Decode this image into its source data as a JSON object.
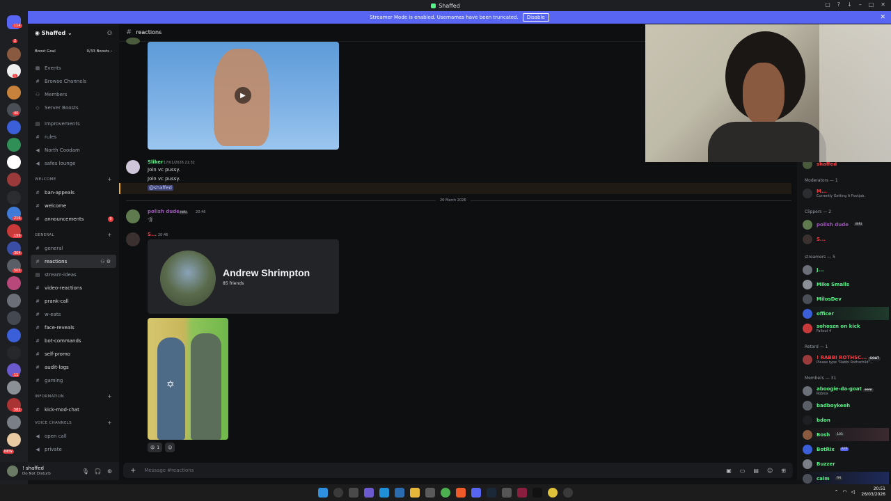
{
  "window": {
    "title": "Shaffed"
  },
  "banner": {
    "text": "Streamer Mode is enabled. Usernames have been truncated.",
    "button": "Disable"
  },
  "guild_badges": [
    "114",
    "2",
    "1",
    "40",
    "216",
    "199",
    "304",
    "505",
    "13",
    "11",
    "582",
    "NEW"
  ],
  "server": {
    "name": "Shaffed",
    "boost_label": "Boost Goal",
    "boost_count": "0/33 Boosts",
    "nav": [
      {
        "label": "Events",
        "icon": "calendar-icon"
      },
      {
        "label": "Browse Channels",
        "icon": "browse-icon"
      },
      {
        "label": "Members",
        "icon": "members-icon"
      },
      {
        "label": "Server Boosts",
        "icon": "boost-icon"
      }
    ],
    "channels_top": [
      "Improvements",
      "rules",
      "North Coodam",
      "safes lounge"
    ],
    "cat_welcome": "WELCOME",
    "welcome_channels": [
      "ban-appeals",
      "welcome",
      "announcements"
    ],
    "announcements_unread": "9",
    "cat_general": "GENERAL",
    "general_channels": [
      "general",
      "reactions",
      "stream-ideas",
      "video-reactions",
      "prank-call",
      "w-eats",
      "face-reveals",
      "bot-commands",
      "self-promo",
      "audit-logs",
      "gaming"
    ],
    "cat_information": "INFORMATION",
    "information_channels": [
      "kick-mod-chat"
    ],
    "cat_voice": "VOICE CHANNELS",
    "voice_channels": [
      "open call",
      "private"
    ]
  },
  "user": {
    "name": "! shaffed",
    "status": "Do Not Disturb"
  },
  "chat": {
    "channel": "reactions",
    "messages": [
      {
        "author": "Sliker",
        "time": "17/01/2026 21:32",
        "lines": [
          "Join vc pussy.",
          "Join vc pussy."
        ],
        "mention": "@shaffed"
      },
      {
        "author": "polish dude",
        "tag": "INRI",
        "time": "20:46",
        "text": "-Jj"
      },
      {
        "author": "S...",
        "time": "20:46"
      }
    ],
    "date_divider": "26 March 2026",
    "profile_card": {
      "name": "Andrew Shrimpton",
      "friends": "85 friends"
    },
    "reactions": [
      {
        "emoji": "😫",
        "count": "1"
      },
      {
        "emoji": "☺",
        "count": ""
      }
    ],
    "composer_placeholder": "Message #reactions"
  },
  "members": {
    "top_partial": "shaffed",
    "cat_moderators": "Moderators — 1",
    "moderators": [
      {
        "name": "M...",
        "sub": "Currently Getting A Footjob."
      }
    ],
    "cat_clippers": "Clippers — 2",
    "clippers": [
      {
        "name": "polish dude",
        "tag": "INRI"
      },
      {
        "name": "S..."
      }
    ],
    "cat_streamers": "streamers — 5",
    "streamers": [
      {
        "name": "J..."
      },
      {
        "name": "Mike Smalls"
      },
      {
        "name": "MilosDev"
      },
      {
        "name": "officer"
      },
      {
        "name": "sohoszn on kick",
        "sub": "Fallout 4"
      }
    ],
    "cat_retard": "Retard — 1",
    "retard": [
      {
        "name": "! RABBI ROTHSC...",
        "tag": "GOAT",
        "sub": "Please type \"Rabbi Rothschild\"..."
      }
    ],
    "cat_members": "Members — 31",
    "members": [
      {
        "name": "aboogie-da-goat",
        "tag": "eem",
        "sub": "Roblox"
      },
      {
        "name": "badboykeeh"
      },
      {
        "name": "bdon"
      },
      {
        "name": "Bosh",
        "tag": "105"
      },
      {
        "name": "BotRix",
        "tag": "APP"
      },
      {
        "name": "Buzzer"
      },
      {
        "name": "calm",
        "tag": "FM"
      }
    ]
  },
  "taskbar": {
    "time": "20:51",
    "date": "26/03/2026"
  },
  "colors": {
    "accent": "#5865f2",
    "green": "#57f287",
    "purple": "#9b59b6",
    "red": "#f23f43"
  }
}
